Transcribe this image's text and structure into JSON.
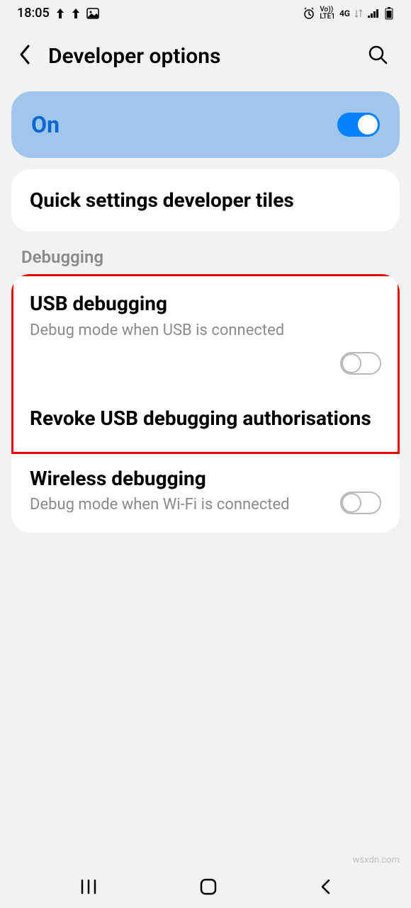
{
  "status_bar": {
    "time": "18:05",
    "network_label": "4G",
    "lte_label": "LTE1",
    "volte_label": "Vo))"
  },
  "header": {
    "title": "Developer options"
  },
  "main_toggle": {
    "label": "On",
    "state": true
  },
  "quick_settings": {
    "title": "Quick settings developer tiles"
  },
  "sections": {
    "debugging_header": "Debugging"
  },
  "settings": {
    "usb_debugging": {
      "title": "USB debugging",
      "desc": "Debug mode when USB is connected",
      "state": false
    },
    "revoke": {
      "title": "Revoke USB debugging authorisations"
    },
    "wireless_debugging": {
      "title": "Wireless debugging",
      "desc": "Debug mode when Wi-Fi is connected",
      "state": false
    }
  },
  "watermark": "wsxdn.com"
}
